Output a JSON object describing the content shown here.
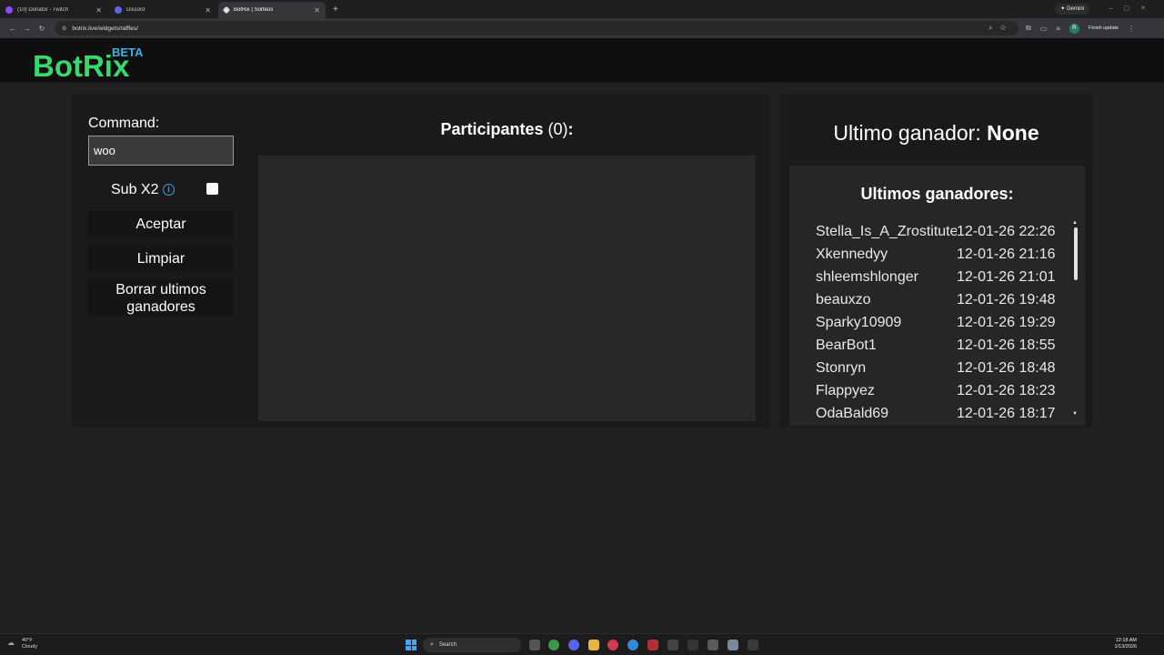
{
  "browser": {
    "tabs": [
      {
        "title": "(10) Donator - Twitch",
        "icon_color": "#9146ff",
        "active": false
      },
      {
        "title": "Discord",
        "icon_color": "#5865f2",
        "active": false
      },
      {
        "title": "BotRix | Sorteos",
        "icon_color": "#dddddd",
        "active": true
      }
    ],
    "url": "botrix.live/widgets/raffles/",
    "gemini_label": "Gemini",
    "profile_initial": "R",
    "finish_update_label": "Finish update"
  },
  "site": {
    "logo": "BotRix",
    "badge": "BETA"
  },
  "raffle": {
    "command_label": "Command:",
    "command_value": "woo",
    "sub_x2_label": "Sub X2",
    "sub_x2_checked": false,
    "accept_label": "Aceptar",
    "clear_label": "Limpiar",
    "delete_label": "Borrar ultimos ganadores",
    "participants_title": "Participantes",
    "participants_count": "(0)",
    "participants_colon": ":"
  },
  "winners": {
    "last_winner_label": "Ultimo ganador:",
    "last_winner_value": "None",
    "list_title": "Ultimos ganadores:",
    "rows": [
      {
        "name": "Stella_Is_A_Zrostitute",
        "date": "12-01-26 22:26"
      },
      {
        "name": "Xkennedyy",
        "date": "12-01-26 21:16"
      },
      {
        "name": "shleemshlonger",
        "date": "12-01-26 21:01"
      },
      {
        "name": "beauxzo",
        "date": "12-01-26 19:48"
      },
      {
        "name": "Sparky10909",
        "date": "12-01-26 19:29"
      },
      {
        "name": "BearBot1",
        "date": "12-01-26 18:55"
      },
      {
        "name": "Stonryn",
        "date": "12-01-26 18:48"
      },
      {
        "name": "Flappyez",
        "date": "12-01-26 18:23"
      },
      {
        "name": "OdaBald69",
        "date": "12-01-26 18:17"
      }
    ]
  },
  "taskbar": {
    "weather_temp": "40°F",
    "weather_desc": "Cloudy",
    "search_label": "Search",
    "time": "12:18 AM",
    "date": "1/13/2026"
  },
  "colors": {
    "logo_green": "#39d86e",
    "beta_blue": "#37b4e8",
    "info_blue": "#3aa0e8"
  }
}
